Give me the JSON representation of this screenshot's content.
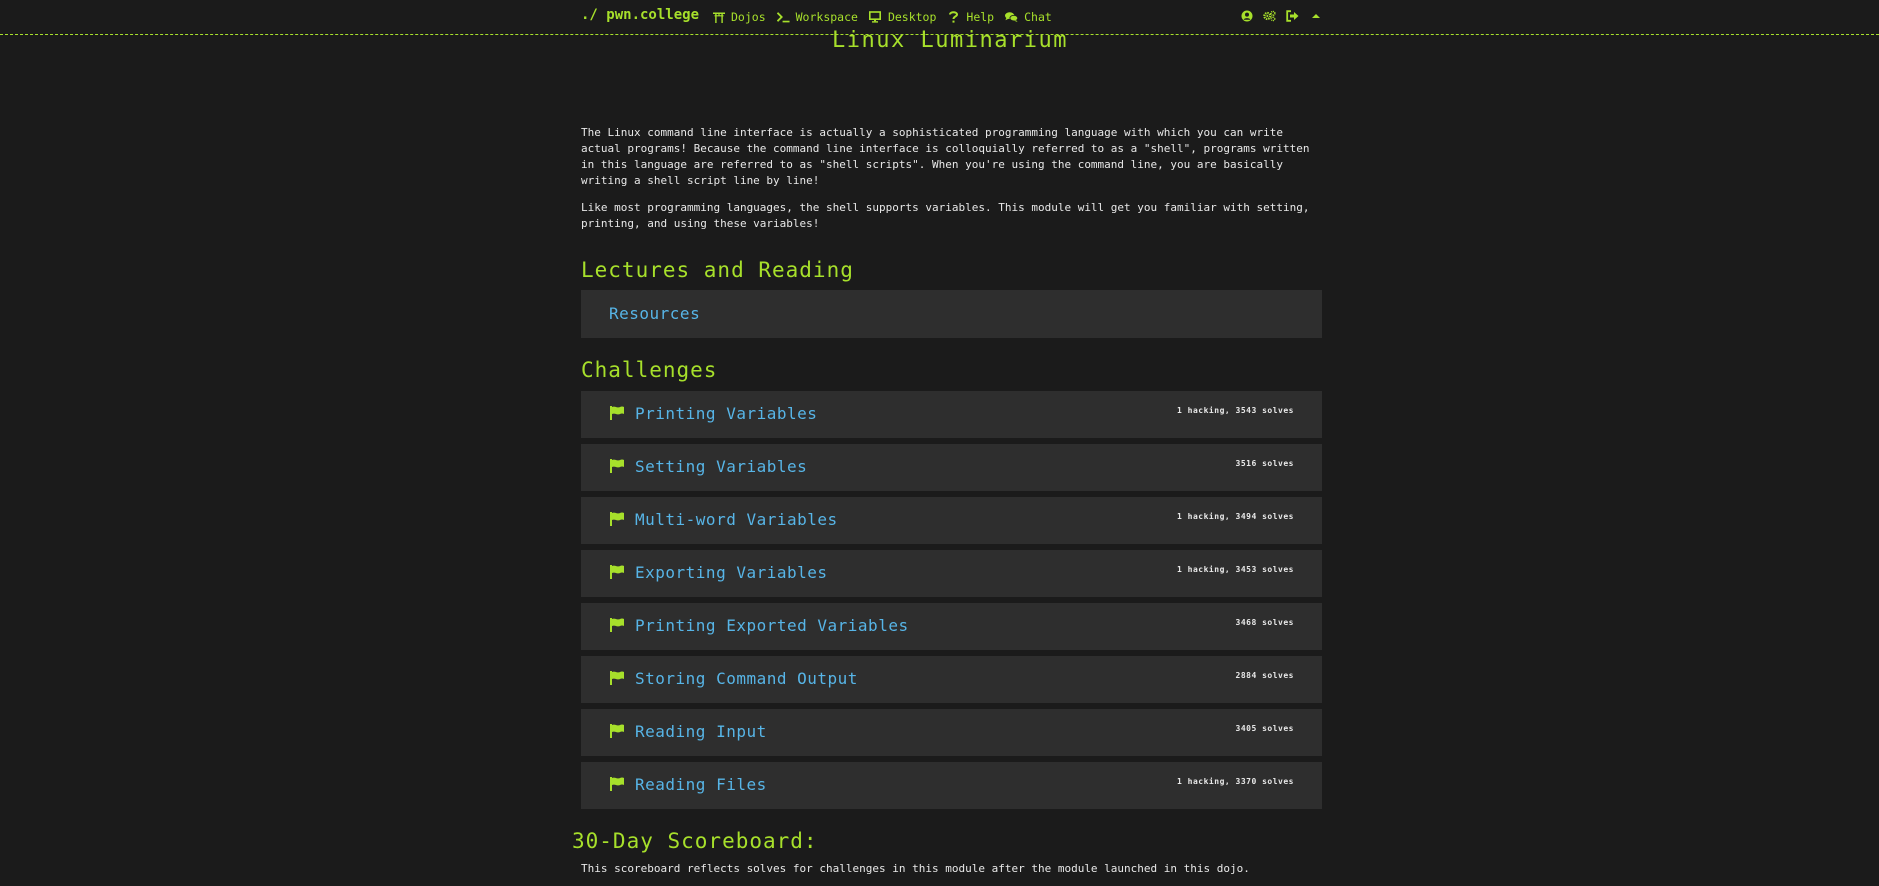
{
  "nav": {
    "brand": "./ pwn.college",
    "links": [
      {
        "label": "Dojos",
        "icon": "torii-gate-icon"
      },
      {
        "label": "Workspace",
        "icon": "terminal-icon"
      },
      {
        "label": "Desktop",
        "icon": "desktop-icon"
      },
      {
        "label": "Help",
        "icon": "question-icon"
      },
      {
        "label": "Chat",
        "icon": "comments-icon"
      }
    ],
    "right_icons": [
      "user-circle-icon",
      "settings-icon",
      "logout-icon",
      "caret-up-icon"
    ]
  },
  "page": {
    "title": "Linux Luminarium",
    "description": [
      "The Linux command line interface is actually a sophisticated programming language with which you can write actual programs! Because the command line interface is colloquially referred to as a \"shell\", programs written in this language are referred to as \"shell scripts\". When you're using the command line, you are basically writing a shell script line by line!",
      "Like most programming languages, the shell supports variables. This module will get you familiar with setting, printing, and using these variables!"
    ]
  },
  "lectures": {
    "heading": "Lectures and Reading",
    "items": [
      {
        "label": "Resources"
      }
    ]
  },
  "challenges": {
    "heading": "Challenges",
    "items": [
      {
        "name": "Printing Variables",
        "stats": "1 hacking, 3543 solves"
      },
      {
        "name": "Setting Variables",
        "stats": "3516 solves"
      },
      {
        "name": "Multi-word Variables",
        "stats": "1 hacking, 3494 solves"
      },
      {
        "name": "Exporting Variables",
        "stats": "1 hacking, 3453 solves"
      },
      {
        "name": "Printing Exported Variables",
        "stats": "3468 solves"
      },
      {
        "name": "Storing Command Output",
        "stats": "2884 solves"
      },
      {
        "name": "Reading Input",
        "stats": "3405 solves"
      },
      {
        "name": "Reading Files",
        "stats": "1 hacking, 3370 solves"
      }
    ]
  },
  "scoreboard": {
    "heading": "30-Day Scoreboard:",
    "description": "This scoreboard reflects solves for challenges in this module after the module launched in this dojo."
  },
  "colors": {
    "accent_green": "#a7e02b",
    "link_blue": "#57b5e7",
    "background": "#1b1b1b",
    "card": "#2e2e2e"
  }
}
